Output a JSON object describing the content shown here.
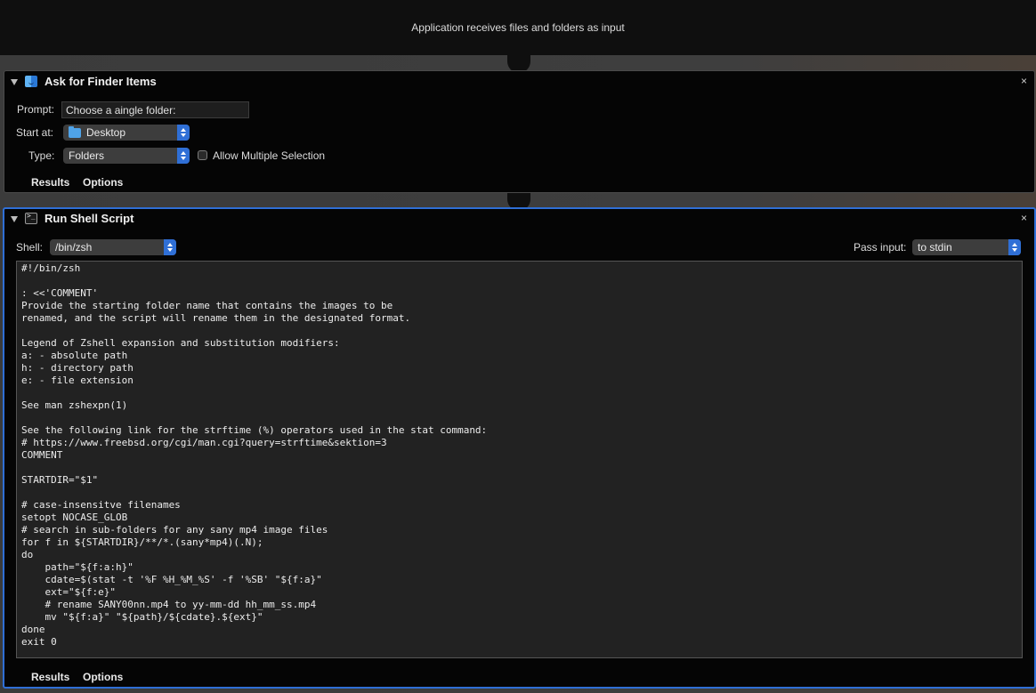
{
  "workflow": {
    "input_description": "Application receives files and folders as input"
  },
  "ask_action": {
    "title": "Ask for Finder Items",
    "icon": "finder-icon",
    "close": "×",
    "prompt_label": "Prompt:",
    "prompt_value": "Choose a aingle folder:",
    "start_label": "Start at:",
    "start_value": "Desktop",
    "type_label": "Type:",
    "type_value": "Folders",
    "allow_multiple_label": "Allow Multiple Selection",
    "allow_multiple_checked": false,
    "tabs": [
      "Results",
      "Options"
    ]
  },
  "shell_action": {
    "title": "Run Shell Script",
    "icon": "terminal-icon",
    "close": "×",
    "shell_label": "Shell:",
    "shell_value": "/bin/zsh",
    "pass_input_label": "Pass input:",
    "pass_input_value": "to stdin",
    "code": "#!/bin/zsh\n\n: <<'COMMENT'\nProvide the starting folder name that contains the images to be\nrenamed, and the script will rename them in the designated format.\n\nLegend of Zshell expansion and substitution modifiers:\na: - absolute path\nh: - directory path\ne: - file extension\n\nSee man zshexpn(1)\n\nSee the following link for the strftime (%) operators used in the stat command:\n# https://www.freebsd.org/cgi/man.cgi?query=strftime&sektion=3\nCOMMENT\n\nSTARTDIR=\"$1\"\n\n# case-insensitve filenames\nsetopt NOCASE_GLOB\n# search in sub-folders for any sany mp4 image files\nfor f in ${STARTDIR}/**/*.(sany*mp4)(.N);\ndo\n    path=\"${f:a:h}\"\n    cdate=$(stat -t '%F %H_%M_%S' -f '%SB' \"${f:a}\"\n    ext=\"${f:e}\"\n    # rename SANY00nn.mp4 to yy-mm-dd hh_mm_ss.mp4\n    mv \"${f:a}\" \"${path}/${cdate}.${ext}\"\ndone\nexit 0",
    "tabs": [
      "Results",
      "Options"
    ]
  },
  "colors": {
    "selection_border": "#2f6fd6",
    "popup_stepper": "#2f6fd6"
  }
}
